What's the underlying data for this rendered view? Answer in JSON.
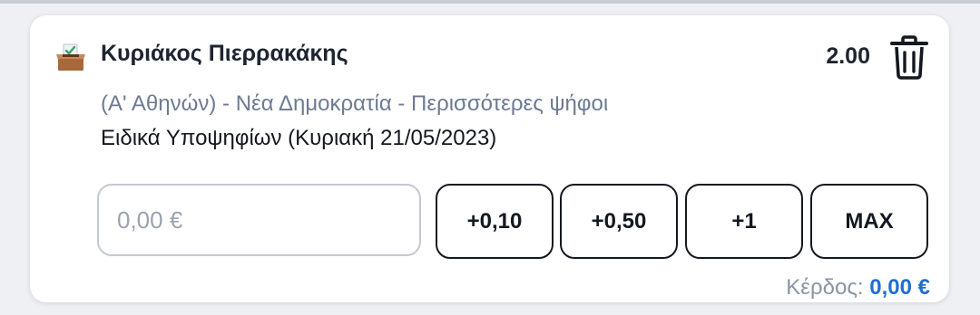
{
  "bet": {
    "icon": "ballot-box-icon",
    "selection": "Κυριάκος Πιερρακάκης",
    "odds": "2.00",
    "market": "(Α' Αθηνών) - Νέα Δημοκρατία - Περισσότερες ψήφοι",
    "event": "Ειδικά Υποψηφίων (Κυριακή 21/05/2023)",
    "delete_icon": "trash-icon"
  },
  "stake": {
    "value": "",
    "placeholder": "0,00 €"
  },
  "quick_buttons": [
    "+0,10",
    "+0,50",
    "+1",
    "MAX"
  ],
  "profit": {
    "label": "Κέρδος:",
    "value": "0,00 €"
  },
  "colors": {
    "accent": "#1f6fd1",
    "muted_text": "#6d7a92",
    "border_dark": "#141820",
    "input_border": "#c3c9d2"
  }
}
